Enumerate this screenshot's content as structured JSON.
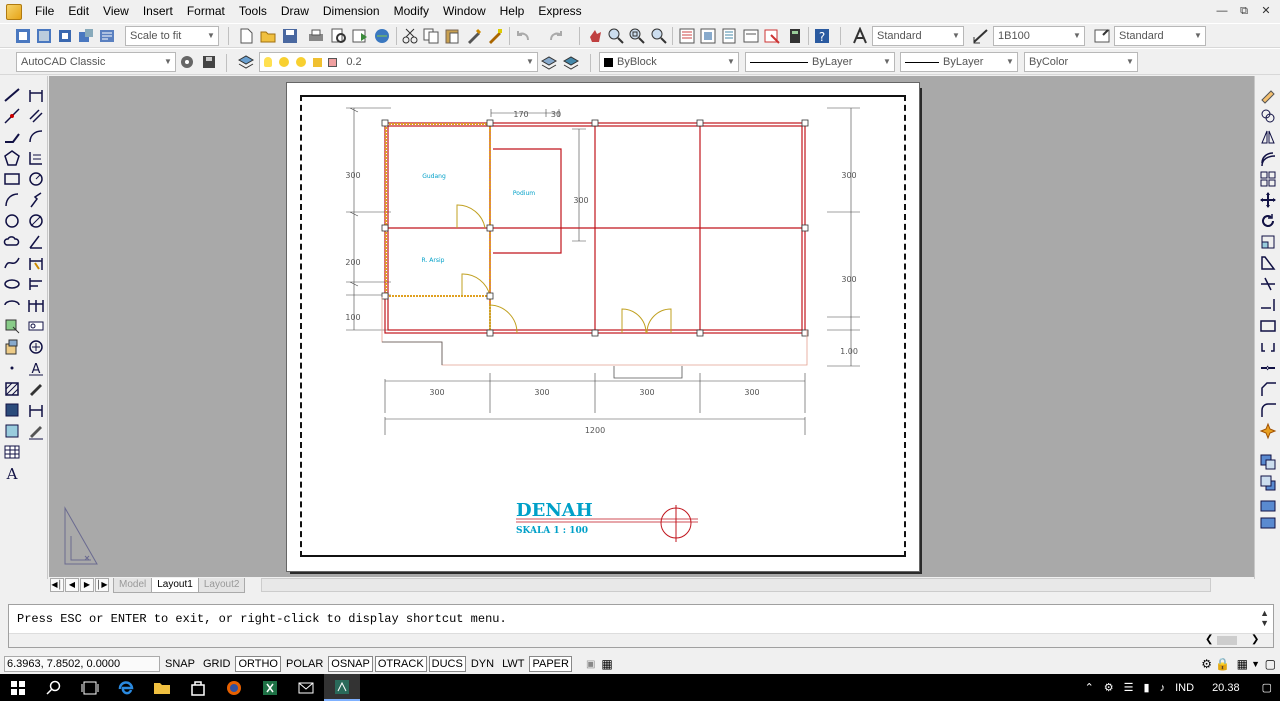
{
  "menubar": {
    "items": [
      "File",
      "Edit",
      "View",
      "Insert",
      "Format",
      "Tools",
      "Draw",
      "Dimension",
      "Modify",
      "Window",
      "Help",
      "Express"
    ]
  },
  "toolbar1": {
    "scale_combo": "Scale to fit",
    "text_style": "Standard",
    "dim_style": "1B100",
    "table_style": "Standard"
  },
  "toolbar2": {
    "workspace": "AutoCAD Classic",
    "layer": "0.2",
    "color": "ByBlock",
    "linetype": "ByLayer",
    "lineweight": "ByLayer",
    "plotstyle": "ByColor"
  },
  "drawing": {
    "dims_top": [
      "170",
      "30"
    ],
    "dims_left": [
      "300",
      "200",
      "100"
    ],
    "dims_right": [
      "300",
      "300",
      "1.00"
    ],
    "dim_inner": "300",
    "dims_bottom": [
      "300",
      "300",
      "300",
      "300"
    ],
    "dim_total": "1200",
    "room_gudang": "Gudang",
    "room_podium": "Podium",
    "room_arsip": "R. Arsip",
    "title": "DENAH",
    "scale_label": "SKALA  1 : 100"
  },
  "tabs": {
    "model": "Model",
    "layout1": "Layout1",
    "layout2": "Layout2"
  },
  "command": {
    "prompt": "Press ESC or ENTER to exit, or right-click to display shortcut menu."
  },
  "statusbar": {
    "coords": "6.3963, 7.8502, 0.0000",
    "buttons": [
      "SNAP",
      "GRID",
      "ORTHO",
      "POLAR",
      "OSNAP",
      "OTRACK",
      "DUCS",
      "DYN",
      "LWT",
      "PAPER"
    ]
  },
  "taskbar": {
    "lang": "IND",
    "time": "20.38"
  },
  "colors": {
    "wall": "#c0141c",
    "hatch": "#e0a020",
    "dim": "#444444",
    "label": "#00a0c8"
  }
}
